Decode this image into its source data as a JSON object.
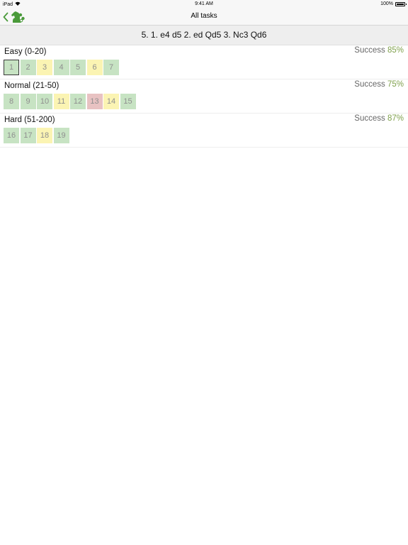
{
  "status_bar": {
    "carrier": "iPad",
    "time": "9:41 AM",
    "battery": "100%"
  },
  "nav": {
    "title": "All tasks"
  },
  "header": {
    "title": "5. 1. e4 d5 2. ed Qd5 3. Nc3 Qd6"
  },
  "colors": {
    "green": "#c7e3c3",
    "yellow": "#fbf4b3",
    "red": "#e8c2c2",
    "success": "#7fa04c",
    "accent": "#4a9a3a"
  },
  "sections": [
    {
      "title": "Easy (0-20)",
      "success_label": "Success",
      "success_pct": "85%",
      "tiles": [
        {
          "label": "1",
          "status": "green",
          "selected": true
        },
        {
          "label": "2",
          "status": "green"
        },
        {
          "label": "3",
          "status": "yellow"
        },
        {
          "label": "4",
          "status": "green"
        },
        {
          "label": "5",
          "status": "green"
        },
        {
          "label": "6",
          "status": "yellow"
        },
        {
          "label": "7",
          "status": "green"
        }
      ]
    },
    {
      "title": "Normal (21-50)",
      "success_label": "Success",
      "success_pct": "75%",
      "tiles": [
        {
          "label": "8",
          "status": "green"
        },
        {
          "label": "9",
          "status": "green"
        },
        {
          "label": "10",
          "status": "green"
        },
        {
          "label": "11",
          "status": "yellow"
        },
        {
          "label": "12",
          "status": "green"
        },
        {
          "label": "13",
          "status": "red"
        },
        {
          "label": "14",
          "status": "yellow"
        },
        {
          "label": "15",
          "status": "green"
        }
      ]
    },
    {
      "title": "Hard (51-200)",
      "success_label": "Success",
      "success_pct": "87%",
      "tiles": [
        {
          "label": "16",
          "status": "green"
        },
        {
          "label": "17",
          "status": "green"
        },
        {
          "label": "18",
          "status": "yellow"
        },
        {
          "label": "19",
          "status": "green"
        }
      ]
    }
  ]
}
